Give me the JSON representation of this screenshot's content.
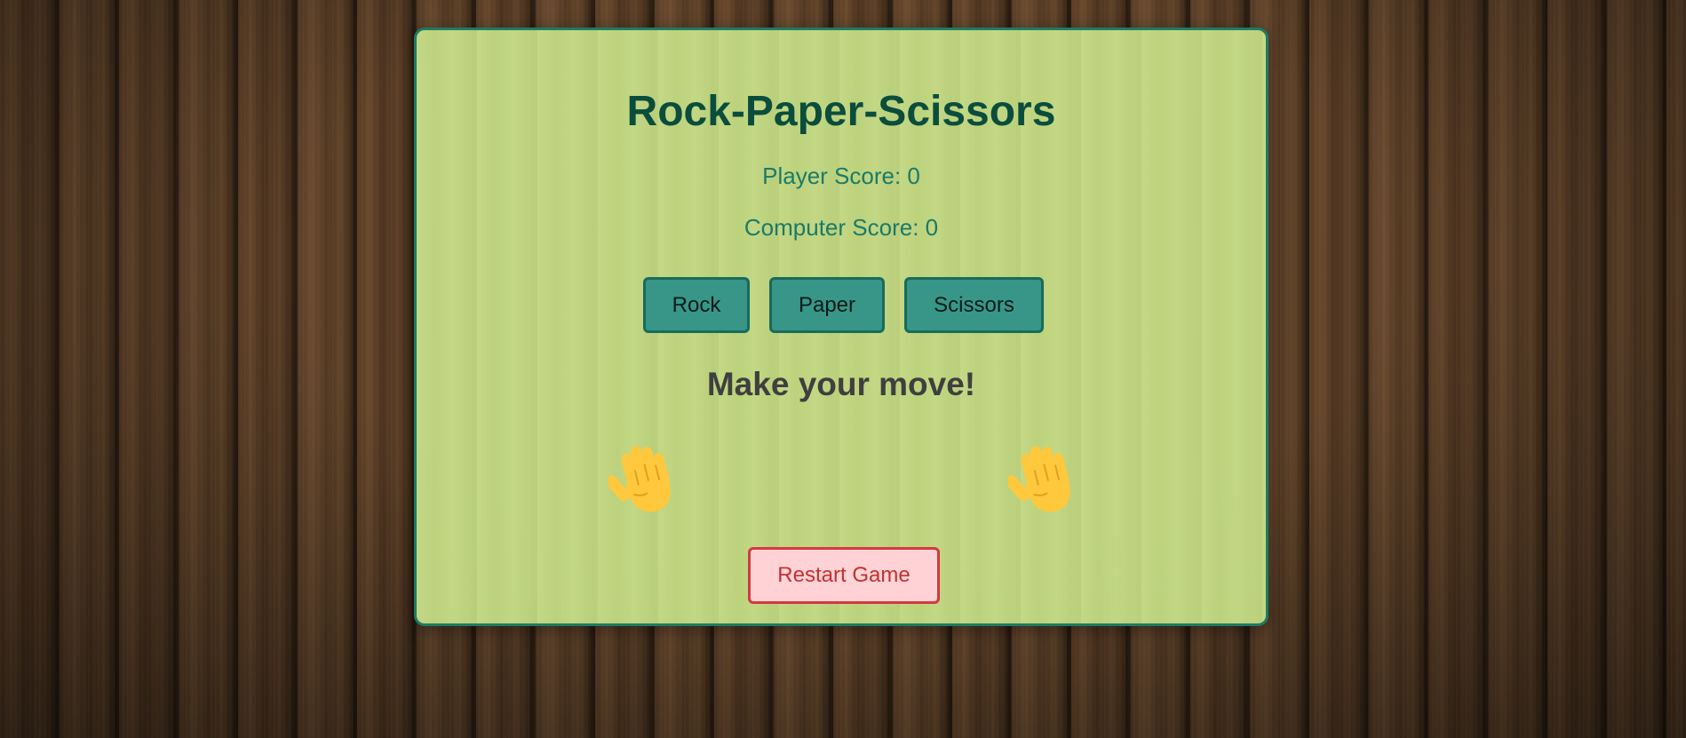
{
  "game": {
    "title": "Rock-Paper-Scissors",
    "player_score": "Player Score: 0",
    "computer_score": "Computer Score: 0",
    "choices": {
      "rock_label": "Rock",
      "paper_label": "Paper",
      "scissors_label": "Scissors"
    },
    "message": "Make your move!",
    "player_hand_icon": "raised-hand-icon",
    "computer_hand_icon": "raised-hand-icon",
    "restart_label": "Restart Game"
  },
  "colors": {
    "card_border": "#1f7a63",
    "title": "#0a4d3c",
    "score_text": "#1a7a68",
    "choice_button_bg": "#389688",
    "restart_bg": "#ffd3d6",
    "restart_border": "#d23a3f",
    "hand": "#ffc83d"
  }
}
